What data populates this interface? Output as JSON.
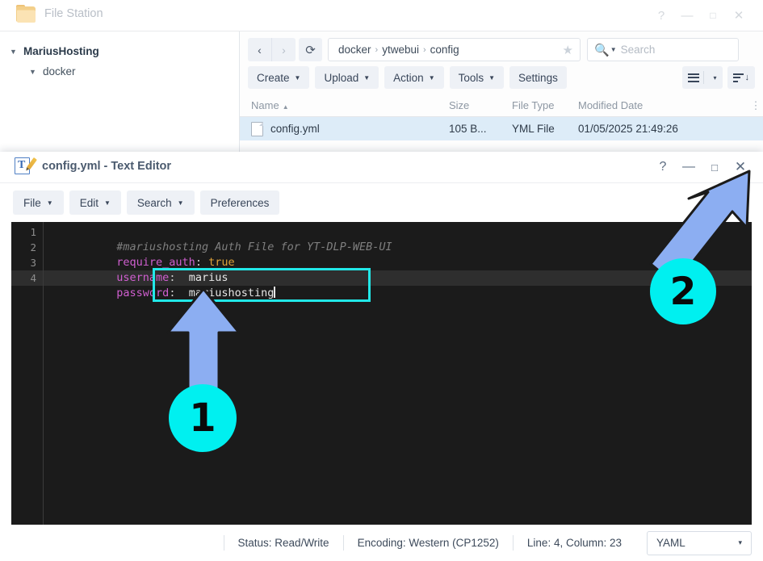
{
  "file_station": {
    "title": "File Station",
    "app_icon": "folder-icon",
    "window_controls": [
      {
        "name": "help-button",
        "glyph": "?"
      },
      {
        "name": "minimize-button",
        "glyph": "—"
      },
      {
        "name": "maximize-button",
        "glyph": "□"
      },
      {
        "name": "close-button",
        "glyph": "✕"
      }
    ],
    "sidebar": {
      "items": [
        {
          "label": "MariusHosting",
          "level": 0,
          "expanded": true
        },
        {
          "label": "docker",
          "level": 1,
          "expanded": true
        }
      ]
    },
    "nav": {
      "back_icon": "chevron-left-icon",
      "forward_icon": "chevron-right-icon",
      "refresh_icon": "refresh-icon",
      "breadcrumb": [
        "docker",
        "ytwebui",
        "config"
      ],
      "breadcrumb_separator": "›",
      "favorite_icon": "star-icon"
    },
    "search": {
      "icon": "search-icon",
      "placeholder": "Search"
    },
    "toolbar": {
      "buttons": [
        {
          "label": "Create",
          "has_menu": true
        },
        {
          "label": "Upload",
          "has_menu": true
        },
        {
          "label": "Action",
          "has_menu": true
        },
        {
          "label": "Tools",
          "has_menu": true
        },
        {
          "label": "Settings",
          "has_menu": false
        }
      ],
      "view_icon": "list-view-icon",
      "view_caret": "▾",
      "sort_icon": "sort-descending-icon"
    },
    "table": {
      "columns": [
        "Name",
        "Size",
        "File Type",
        "Modified Date"
      ],
      "sort_column": "Name",
      "sort_direction": "asc",
      "sort_glyph": "▲",
      "more_glyph": "⋮",
      "rows": [
        {
          "icon": "file-icon",
          "name": "config.yml",
          "size": "105 B...",
          "type": "YML File",
          "modified": "01/05/2025 21:49:26",
          "selected": true
        }
      ]
    }
  },
  "text_editor": {
    "title": "config.yml - Text Editor",
    "app_icon": "text-editor-icon",
    "window_controls": [
      {
        "name": "help-button",
        "glyph": "?"
      },
      {
        "name": "minimize-button",
        "glyph": "—"
      },
      {
        "name": "maximize-button",
        "glyph": "□"
      },
      {
        "name": "close-button",
        "glyph": "✕"
      }
    ],
    "menubar": [
      {
        "label": "File",
        "has_menu": true
      },
      {
        "label": "Edit",
        "has_menu": true
      },
      {
        "label": "Search",
        "has_menu": true
      },
      {
        "label": "Preferences",
        "has_menu": false
      }
    ],
    "code": {
      "lines": [
        {
          "num": "1",
          "comment": "#mariushosting Auth File for YT-DLP-WEB-UI"
        },
        {
          "num": "2",
          "key": "require_auth",
          "colon": ":",
          "bool": "true"
        },
        {
          "num": "3",
          "key": "username",
          "colon": ":",
          "value": "marius"
        },
        {
          "num": "4",
          "key": "password",
          "colon": ":",
          "value": "mariushosting",
          "active": true
        }
      ]
    },
    "statusbar": {
      "status": "Status: Read/Write",
      "encoding": "Encoding: Western (CP1252)",
      "position": "Line: 4, Column: 23",
      "syntax": "YAML",
      "syntax_caret": "▾"
    }
  },
  "annotations": {
    "arrow_color": "#8CAEF2",
    "badge_color": "#00F0F0",
    "items": [
      {
        "number": "1",
        "points_to": "credential-values"
      },
      {
        "number": "2",
        "points_to": "editor-close-button"
      }
    ]
  }
}
